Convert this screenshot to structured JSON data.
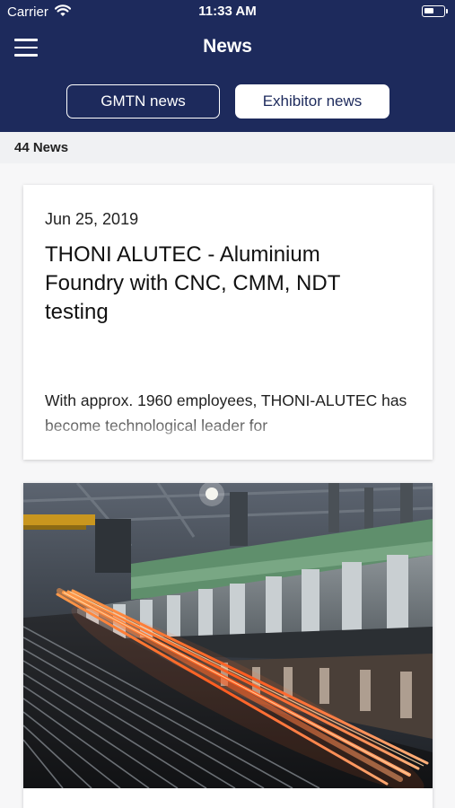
{
  "status_bar": {
    "carrier": "Carrier",
    "time": "11:33 AM"
  },
  "header": {
    "title": "News",
    "menu_icon": "hamburger-menu-icon",
    "tabs": [
      {
        "label": "GMTN news",
        "selected": false
      },
      {
        "label": "Exhibitor news",
        "selected": true
      }
    ]
  },
  "news_count": "44 News",
  "articles": [
    {
      "date": "Jun 25, 2019",
      "title": "THONI ALUTEC - Aluminium Foundry with CNC, CMM, NDT testing",
      "excerpt": "With approx. 1960 employees, THONI-ALUTEC has become technological leader for"
    },
    {
      "image": "steel-rolling-mill-photo"
    }
  ],
  "colors": {
    "header_bg": "#1d2a5c",
    "count_bar_bg": "#f0f1f3",
    "content_bg": "#f7f7f8"
  }
}
